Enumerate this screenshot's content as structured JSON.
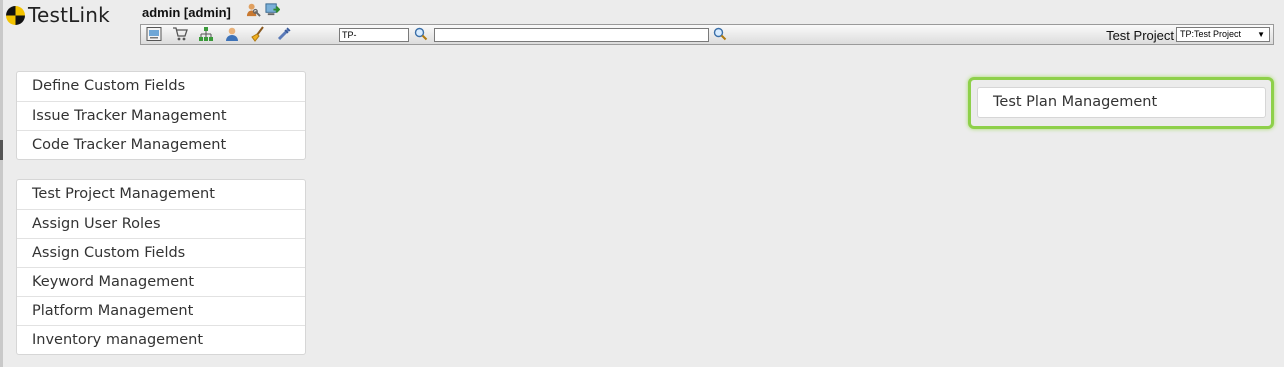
{
  "app": {
    "logo_text": "TestLink"
  },
  "header": {
    "user_label": "admin [admin]",
    "toolbar_icons": [
      "desktop-icon",
      "cart-icon",
      "sitemap-icon",
      "user-icon",
      "broom-icon",
      "plug-icon"
    ],
    "testcase_id_input": "TP-",
    "search_value": "",
    "project_label": "Test Project",
    "project_select": "TP:Test Project"
  },
  "menu_system": {
    "items": [
      "Define Custom Fields",
      "Issue Tracker Management",
      "Code Tracker Management"
    ]
  },
  "menu_project": {
    "items": [
      "Test Project Management",
      "Assign User Roles",
      "Assign Custom Fields",
      "Keyword Management",
      "Platform Management",
      "Inventory management"
    ]
  },
  "menu_plan": {
    "items": [
      "Test Plan Management"
    ]
  },
  "colors": {
    "highlight": "#8ed04a",
    "background": "#ececec"
  }
}
